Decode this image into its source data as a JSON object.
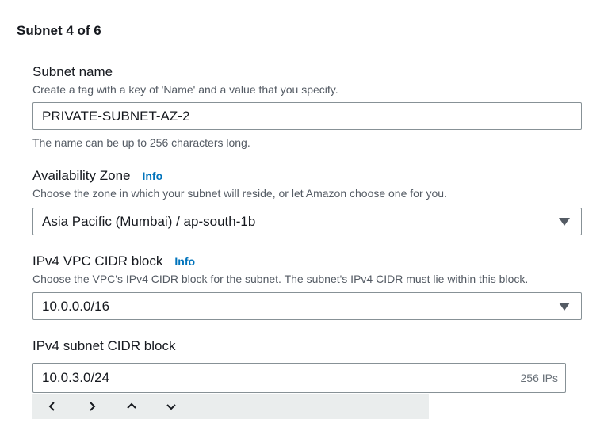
{
  "section": {
    "title": "Subnet 4 of 6"
  },
  "subnet_name": {
    "label": "Subnet name",
    "description": "Create a tag with a key of 'Name' and a value that you specify.",
    "value": "PRIVATE-SUBNET-AZ-2",
    "hint": "The name can be up to 256 characters long."
  },
  "availability_zone": {
    "label": "Availability Zone",
    "info": "Info",
    "description": "Choose the zone in which your subnet will reside, or let Amazon choose one for you.",
    "selected": "Asia Pacific (Mumbai) / ap-south-1b"
  },
  "vpc_cidr": {
    "label": "IPv4 VPC CIDR block",
    "info": "Info",
    "description": "Choose the VPC's IPv4 CIDR block for the subnet. The subnet's IPv4 CIDR must lie within this block.",
    "selected": "10.0.0.0/16"
  },
  "subnet_cidr": {
    "label": "IPv4 subnet CIDR block",
    "value": "10.0.3.0/24",
    "suffix": "256 IPs"
  },
  "stepper": {
    "icons": [
      "chevron-left-icon",
      "chevron-right-icon",
      "chevron-up-icon",
      "chevron-down-icon"
    ]
  },
  "colors": {
    "info_link": "#0073bb",
    "border": "#879196",
    "stepper_bg": "#eaeded"
  }
}
